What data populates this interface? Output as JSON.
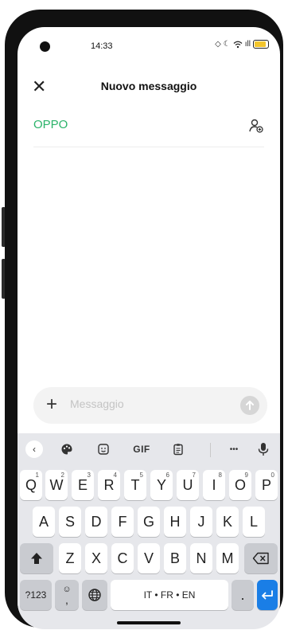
{
  "status_bar": {
    "time": "14:33",
    "signal_label": "ıll"
  },
  "header": {
    "close_symbol": "✕",
    "title": "Nuovo messaggio"
  },
  "recipient": {
    "name": "OPPO"
  },
  "composer": {
    "placeholder": "Messaggio",
    "plus_symbol": "+"
  },
  "toolbar": {
    "back_symbol": "‹",
    "gif_label": "GIF",
    "more_label": "•••"
  },
  "keyboard": {
    "row1": [
      {
        "label": "Q",
        "sub": "1"
      },
      {
        "label": "W",
        "sub": "2"
      },
      {
        "label": "E",
        "sub": "3"
      },
      {
        "label": "R",
        "sub": "4"
      },
      {
        "label": "T",
        "sub": "5"
      },
      {
        "label": "Y",
        "sub": "6"
      },
      {
        "label": "U",
        "sub": "7"
      },
      {
        "label": "I",
        "sub": "8"
      },
      {
        "label": "O",
        "sub": "9"
      },
      {
        "label": "P",
        "sub": "0"
      }
    ],
    "row2": [
      "A",
      "S",
      "D",
      "F",
      "G",
      "H",
      "J",
      "K",
      "L"
    ],
    "row3": [
      "Z",
      "X",
      "C",
      "V",
      "B",
      "N",
      "M"
    ],
    "symbols_key": "?123",
    "emoji_comma_key": ",",
    "space_label": "IT • FR • EN",
    "period_key": "."
  },
  "colors": {
    "accent_green": "#2bb36a",
    "enter_blue": "#1a7ee6",
    "keyboard_bg": "#e6e7eb"
  }
}
